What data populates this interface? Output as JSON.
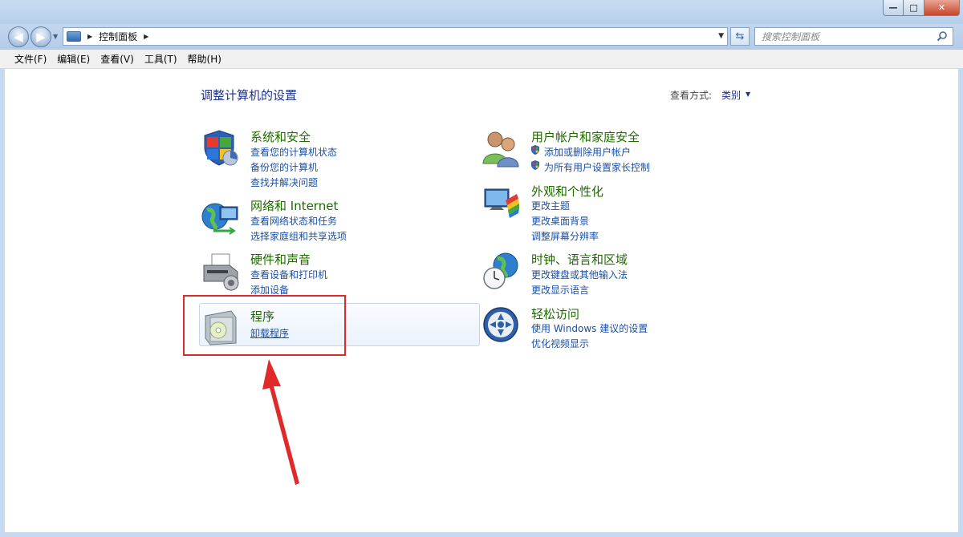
{
  "window": {
    "minimize": "—",
    "maximize": "□",
    "close": "✕"
  },
  "nav": {
    "breadcrumb": "控制面板",
    "search_placeholder": "搜索控制面板"
  },
  "menu": [
    "文件(F)",
    "编辑(E)",
    "查看(V)",
    "工具(T)",
    "帮助(H)"
  ],
  "content": {
    "title": "调整计算机的设置",
    "view_label": "查看方式:",
    "view_value": "类别"
  },
  "categories": {
    "system": {
      "title": "系统和安全",
      "links": [
        "查看您的计算机状态",
        "备份您的计算机",
        "查找并解决问题"
      ]
    },
    "network": {
      "title": "网络和 Internet",
      "links": [
        "查看网络状态和任务",
        "选择家庭组和共享选项"
      ]
    },
    "hardware": {
      "title": "硬件和声音",
      "links": [
        "查看设备和打印机",
        "添加设备"
      ]
    },
    "programs": {
      "title": "程序",
      "links": [
        "卸载程序"
      ]
    },
    "users": {
      "title": "用户帐户和家庭安全",
      "links": [
        "添加或删除用户帐户",
        "为所有用户设置家长控制"
      ]
    },
    "appearance": {
      "title": "外观和个性化",
      "links": [
        "更改主题",
        "更改桌面背景",
        "调整屏幕分辨率"
      ]
    },
    "clock": {
      "title": "时钟、语言和区域",
      "links": [
        "更改键盘或其他输入法",
        "更改显示语言"
      ]
    },
    "ease": {
      "title": "轻松访问",
      "links": [
        "使用 Windows 建议的设置",
        "优化视频显示"
      ]
    }
  },
  "colors": {
    "category_title": "#1f6b00",
    "link": "#1a4fa5",
    "heading": "#1e3287",
    "annotation": "#e02929"
  }
}
